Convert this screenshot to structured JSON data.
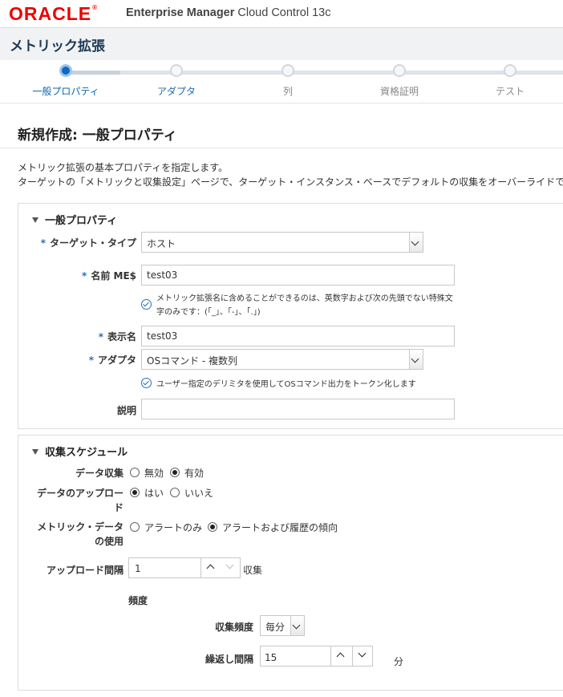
{
  "header": {
    "logo": "ORACLE",
    "title_bold": "Enterprise Manager",
    "title_rest": " Cloud Control 13c"
  },
  "page": {
    "title": "メトリック拡張"
  },
  "train": {
    "steps": [
      {
        "label": "一般プロパティ"
      },
      {
        "label": "アダプタ"
      },
      {
        "label": "列"
      },
      {
        "label": "資格証明"
      },
      {
        "label": "テスト"
      }
    ]
  },
  "section": {
    "title": "新規作成: 一般プロパティ",
    "desc1": "メトリック拡張の基本プロパティを指定します。",
    "desc2": "ターゲットの「メトリックと収集設定」ページで、ターゲット・インスタンス・ベースでデフォルトの収集をオーバーライドで"
  },
  "general": {
    "header": "一般プロパティ",
    "target_type_label": "ターゲット・タイプ",
    "target_type_value": "ホスト",
    "name_label": "名前 ME$",
    "name_value": "test03",
    "name_hint1": "メトリック拡張名に含めることができるのは、英数字および次の先頭でない特殊文",
    "name_hint2": "字のみです：(「_」、「-」、「.」)",
    "display_label": "表示名",
    "display_value": "test03",
    "adapter_label": "アダプタ",
    "adapter_value": "OSコマンド - 複数列",
    "adapter_hint": "ユーザー指定のデリミタを使用してOSコマンド出力をトークン化します",
    "desc_label": "説明",
    "desc_value": ""
  },
  "schedule": {
    "header": "収集スケジュール",
    "data_collection_label": "データ収集",
    "dc_disabled": "無効",
    "dc_enabled": "有効",
    "upload_label1": "データのアップロー",
    "upload_label2": "ド",
    "upload_yes": "はい",
    "upload_no": "いいえ",
    "use_label1": "メトリック・データ",
    "use_label2": "の使用",
    "use_alert_only": "アラートのみ",
    "use_alert_history": "アラートおよび履歴の傾向",
    "upload_interval_label": "アップロード間隔",
    "upload_interval_value": "1",
    "upload_interval_unit": "収集",
    "frequency_header": "頻度",
    "freq_label": "収集頻度",
    "freq_value": "毎分",
    "repeat_label": "繰返し間隔",
    "repeat_value": "15",
    "repeat_unit": "分"
  }
}
